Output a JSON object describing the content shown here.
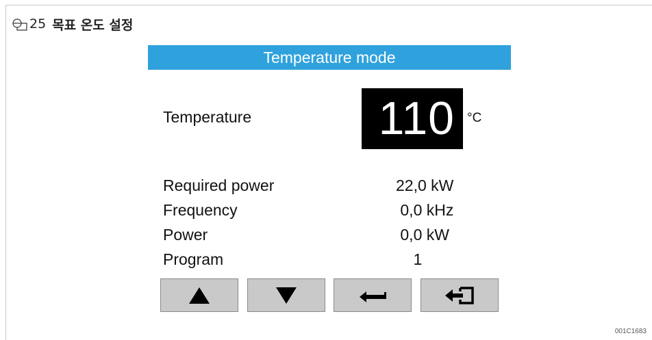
{
  "figure": {
    "number": "25",
    "title": "목표 온도 설정",
    "ref_code": "001C1683",
    "icon": "figure-icon"
  },
  "screen": {
    "title": "Temperature mode",
    "title_bar_color": "#2fa2dd",
    "temperature": {
      "label": "Temperature",
      "value": "110",
      "unit": "°C"
    },
    "params": [
      {
        "label": "Required power",
        "value": "22,0 kW"
      },
      {
        "label": "Frequency",
        "value": " 0,0 kHz"
      },
      {
        "label": "Power",
        "value": " 0,0 kW"
      },
      {
        "label": "Program",
        "value": "    1"
      }
    ],
    "buttons": [
      {
        "name": "up-button",
        "icon": "triangle-up-icon"
      },
      {
        "name": "down-button",
        "icon": "triangle-down-icon"
      },
      {
        "name": "enter-button",
        "icon": "enter-arrow-icon"
      },
      {
        "name": "exit-button",
        "icon": "exit-arrow-icon"
      }
    ]
  }
}
